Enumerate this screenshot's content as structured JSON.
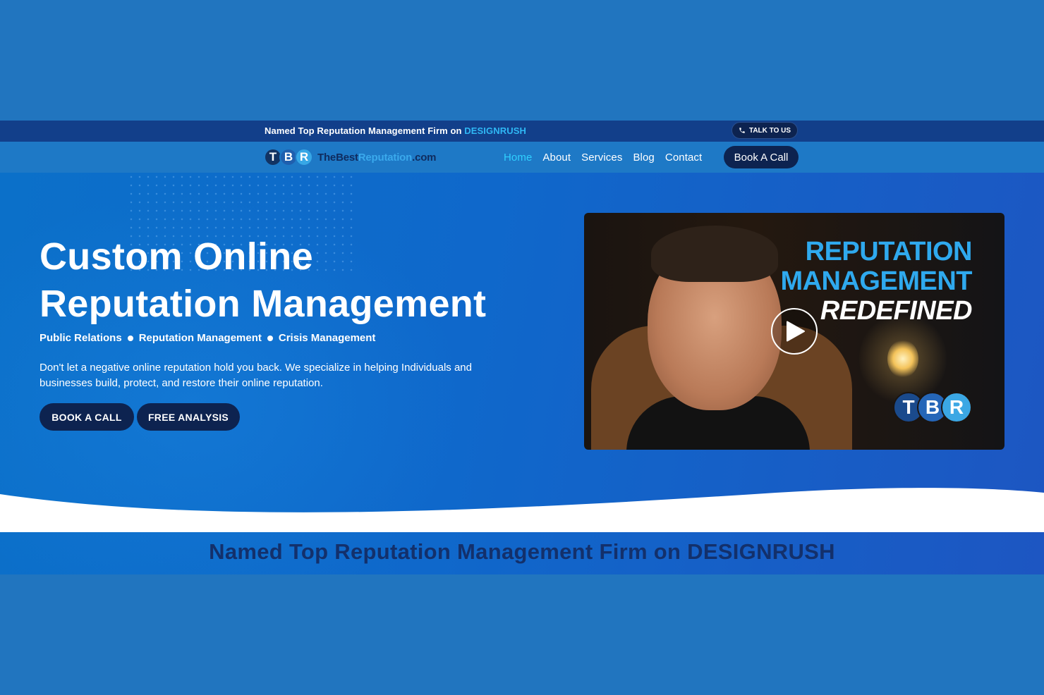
{
  "topbar": {
    "text_prefix": "Named Top Reputation Management Firm on ",
    "text_accent": "DESIGNRUSH",
    "talk_label": "TALK TO US"
  },
  "logo": {
    "letters": [
      "T",
      "B",
      "R"
    ],
    "text_part1": "TheBest",
    "text_part2": "Reputation",
    "text_part3": ".com"
  },
  "nav": {
    "items": [
      {
        "label": "Home",
        "active": true
      },
      {
        "label": "About",
        "active": false
      },
      {
        "label": "Services",
        "active": false
      },
      {
        "label": "Blog",
        "active": false
      },
      {
        "label": "Contact",
        "active": false
      }
    ],
    "cta_label": "Book A Call"
  },
  "hero": {
    "title_line1": "Custom Online",
    "title_line2": "Reputation Management",
    "tags": [
      "Public Relations",
      "Reputation Management",
      "Crisis Management"
    ],
    "description": "Don't let a negative online reputation hold you back. We specialize in helping Individuals and businesses build, protect, and restore their online reputation.",
    "buttons": {
      "book": "BOOK A CALL",
      "free": "FREE ANALYSIS"
    }
  },
  "video": {
    "title_line1": "REPUTATION",
    "title_line2": "MANAGEMENT",
    "title_line3": "REDEFINED",
    "logo_letters": [
      "T",
      "B",
      "R"
    ]
  },
  "section": {
    "heading": "Named Top Reputation Management Firm on DESIGNRUSH"
  },
  "colors": {
    "page_background": "#2175bf",
    "topbar": "#123f8a",
    "navbar": "#1e79c6",
    "accent": "#2fb8f5",
    "dark_button": "#0d2350",
    "heading": "#13306b"
  }
}
